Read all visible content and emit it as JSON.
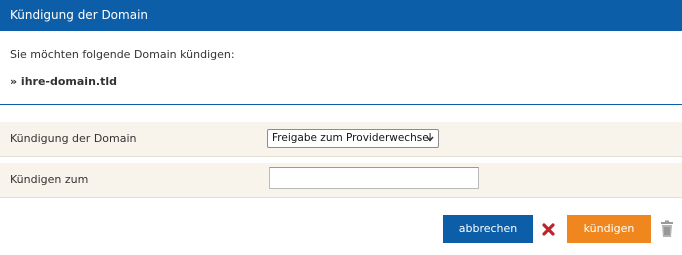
{
  "header": {
    "title": "Kündigung der Domain"
  },
  "intro": {
    "text": "Sie möchten folgende Domain kündigen:",
    "domain": "» ihre-domain.tld"
  },
  "form": {
    "row1": {
      "label": "Kündigung der Domain",
      "selected_option": "Freigabe zum Providerwechsel"
    },
    "row2": {
      "label": "Kündigen zum",
      "value": ""
    }
  },
  "actions": {
    "cancel_label": "abbrechen",
    "submit_label": "kündigen"
  },
  "colors": {
    "header_blue": "#0c5ea8",
    "submit_orange": "#f0871e",
    "row_background": "#f8f4ec",
    "cancel_icon_red": "#c0242b"
  },
  "icons": {
    "cancel": "close-icon",
    "delete": "trash-icon",
    "select": "chevron-down-icon"
  }
}
